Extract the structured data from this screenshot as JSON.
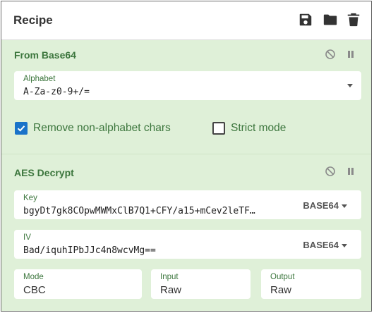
{
  "header": {
    "title": "Recipe",
    "icons": [
      "save-icon",
      "folder-icon",
      "trash-icon"
    ]
  },
  "operations": [
    {
      "title": "From Base64",
      "alphabet": {
        "label": "Alphabet",
        "value": "A-Za-z0-9+/="
      },
      "remove_non_alpha": {
        "label": "Remove non-alphabet chars",
        "checked": true
      },
      "strict_mode": {
        "label": "Strict mode",
        "checked": false
      }
    },
    {
      "title": "AES Decrypt",
      "key": {
        "label": "Key",
        "value": "bgyDt7gk8COpwMWMxClB7Q1+CFY/a15+mCev2leTF…",
        "encoding": "BASE64"
      },
      "iv": {
        "label": "IV",
        "value": "Bad/iquhIPbJJc4n8wcvMg==",
        "encoding": "BASE64"
      },
      "mode": {
        "label": "Mode",
        "value": "CBC"
      },
      "input": {
        "label": "Input",
        "value": "Raw"
      },
      "output": {
        "label": "Output",
        "value": "Raw"
      }
    }
  ],
  "colors": {
    "op_bg": "#dff0d8",
    "op_title": "#3c763d",
    "checkbox_checked": "#1a73c9"
  }
}
